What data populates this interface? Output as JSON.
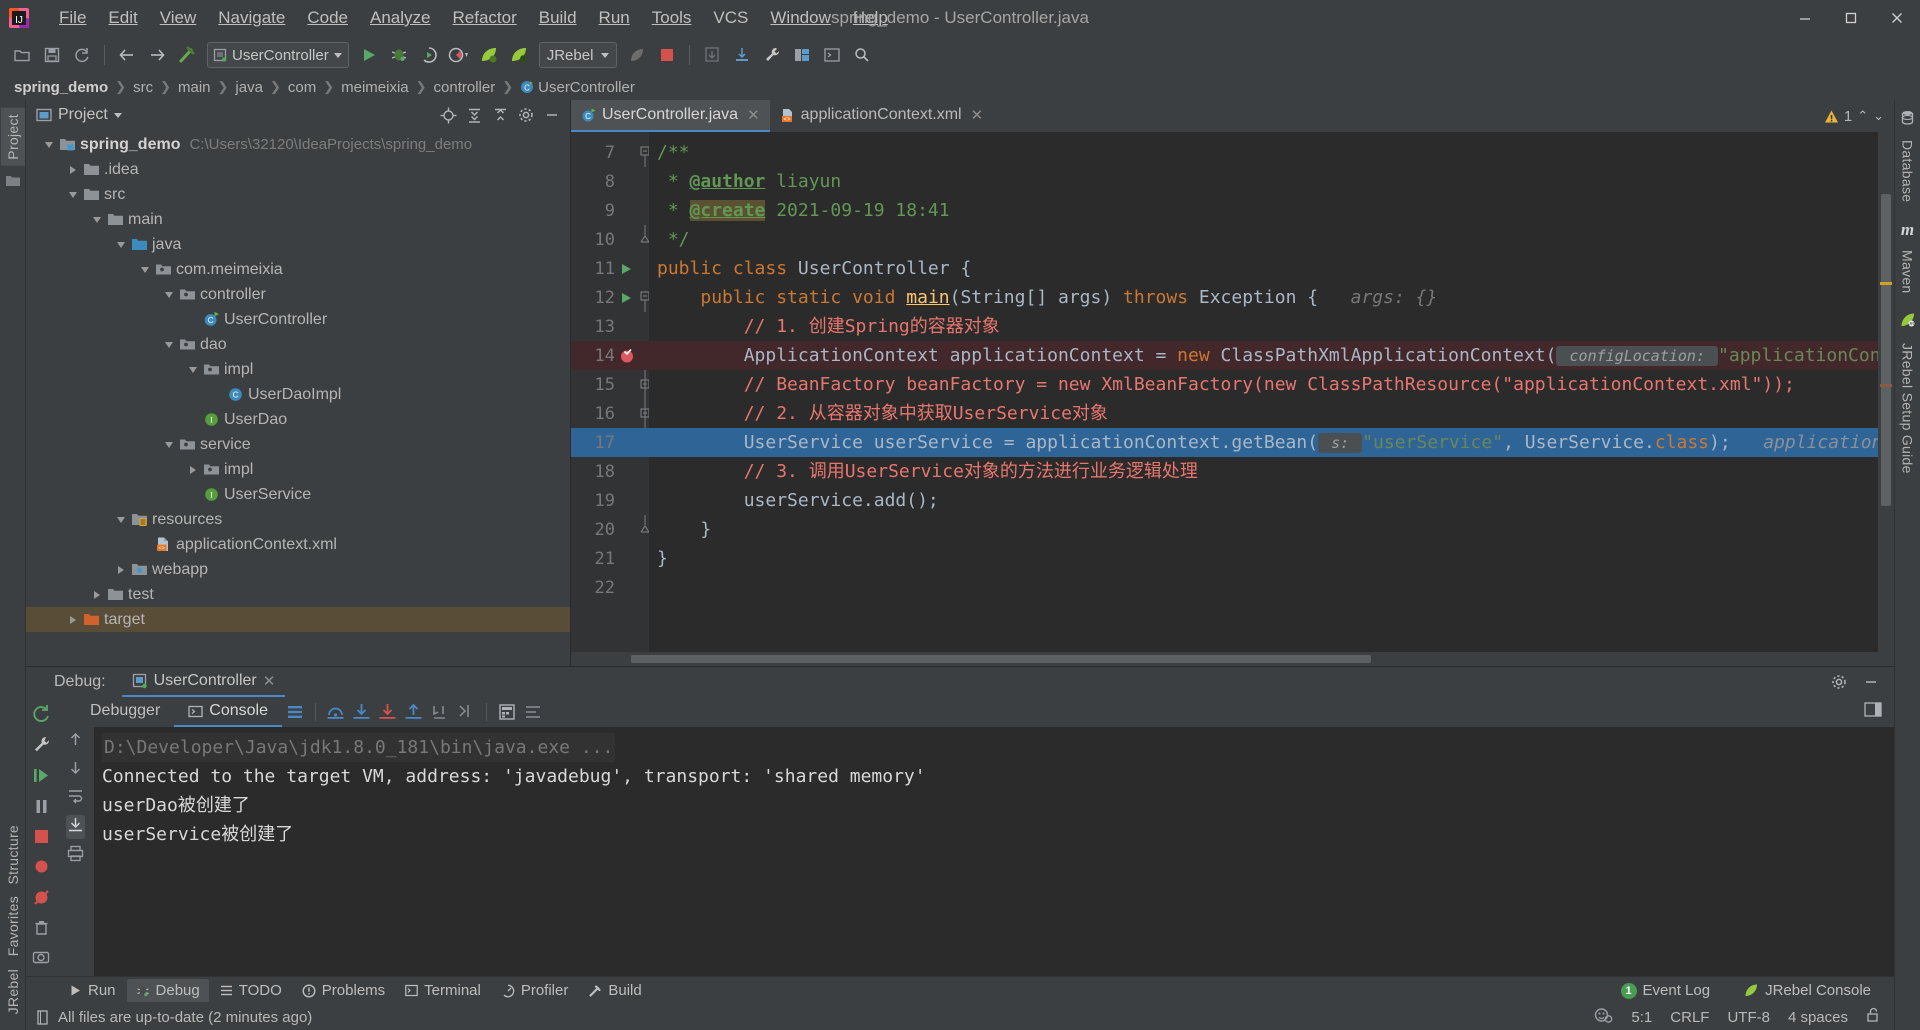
{
  "window": {
    "title": "spring_demo - UserController.java",
    "controls": [
      "minimize",
      "maximize",
      "close"
    ]
  },
  "menubar": [
    {
      "label": "File",
      "mnemonic": "F"
    },
    {
      "label": "Edit",
      "mnemonic": "E"
    },
    {
      "label": "View",
      "mnemonic": "V"
    },
    {
      "label": "Navigate",
      "mnemonic": "N"
    },
    {
      "label": "Code",
      "mnemonic": "C"
    },
    {
      "label": "Analyze",
      "mnemonic": "A"
    },
    {
      "label": "Refactor",
      "mnemonic": "R"
    },
    {
      "label": "Build",
      "mnemonic": "B"
    },
    {
      "label": "Run",
      "mnemonic": "u"
    },
    {
      "label": "Tools",
      "mnemonic": "T"
    },
    {
      "label": "VCS",
      "mnemonic": "V"
    },
    {
      "label": "Window",
      "mnemonic": "W"
    },
    {
      "label": "Help",
      "mnemonic": "H"
    }
  ],
  "toolbar": {
    "run_config": "UserController",
    "jrebel_label": "JRebel",
    "icons": [
      "open-folder-icon",
      "save-all-icon",
      "sync-icon",
      "back-arrow-icon",
      "forward-arrow-icon",
      "build-icon",
      "run-icon",
      "debug-icon",
      "run-coverage-icon",
      "profile-icon",
      "jrebel-run-icon",
      "jrebel-debug-icon",
      "attach-icon",
      "stop-icon",
      "layout-icon",
      "update-icon",
      "wrench-icon",
      "project-structure-icon",
      "terminal-icon",
      "search-everywhere-icon"
    ]
  },
  "breadcrumb": [
    {
      "label": "spring_demo",
      "bold": true,
      "icon": ""
    },
    {
      "label": "src",
      "bold": false,
      "icon": ""
    },
    {
      "label": "main",
      "bold": false,
      "icon": ""
    },
    {
      "label": "java",
      "bold": false,
      "icon": ""
    },
    {
      "label": "com",
      "bold": false,
      "icon": ""
    },
    {
      "label": "meimeixia",
      "bold": false,
      "icon": ""
    },
    {
      "label": "controller",
      "bold": false,
      "icon": ""
    },
    {
      "label": "UserController",
      "bold": false,
      "icon": "java-class-icon"
    }
  ],
  "left_tool_tabs": [
    {
      "label": "Project",
      "selected": true
    },
    {
      "label": "Structure",
      "selected": false
    },
    {
      "label": "Favorites",
      "selected": false
    },
    {
      "label": "JRebel",
      "selected": false
    }
  ],
  "right_tool_tabs": [
    {
      "label": "Database",
      "icon": "database-icon"
    },
    {
      "label": "Maven",
      "icon": "maven-m-icon"
    },
    {
      "label": "JRebel Setup Guide",
      "icon": "jrebel-leaf-icon"
    }
  ],
  "project_panel": {
    "title": "Project",
    "actions": [
      "locate-icon",
      "collapse-all-icon",
      "expand-icon",
      "settings-gear-icon",
      "hide-icon"
    ],
    "tree": [
      {
        "depth": 0,
        "twisty": "down",
        "icon": "module-folder-icon",
        "label": "spring_demo",
        "bold": true,
        "path": "C:\\Users\\32120\\IdeaProjects\\spring_demo",
        "highlight": false
      },
      {
        "depth": 1,
        "twisty": "right",
        "icon": "folder-icon",
        "label": ".idea",
        "bold": false,
        "path": "",
        "highlight": false
      },
      {
        "depth": 1,
        "twisty": "down",
        "icon": "folder-icon",
        "label": "src",
        "bold": false,
        "path": "",
        "highlight": false
      },
      {
        "depth": 2,
        "twisty": "down",
        "icon": "folder-icon",
        "label": "main",
        "bold": false,
        "path": "",
        "highlight": false
      },
      {
        "depth": 3,
        "twisty": "down",
        "icon": "source-folder-icon",
        "label": "java",
        "bold": false,
        "path": "",
        "highlight": false
      },
      {
        "depth": 4,
        "twisty": "down",
        "icon": "package-icon",
        "label": "com.meimeixia",
        "bold": false,
        "path": "",
        "highlight": false
      },
      {
        "depth": 5,
        "twisty": "down",
        "icon": "package-icon",
        "label": "controller",
        "bold": false,
        "path": "",
        "highlight": false
      },
      {
        "depth": 6,
        "twisty": "none",
        "icon": "java-class-run-icon",
        "label": "UserController",
        "bold": false,
        "path": "",
        "highlight": false
      },
      {
        "depth": 5,
        "twisty": "down",
        "icon": "package-icon",
        "label": "dao",
        "bold": false,
        "path": "",
        "highlight": false
      },
      {
        "depth": 6,
        "twisty": "down",
        "icon": "package-icon",
        "label": "impl",
        "bold": false,
        "path": "",
        "highlight": false
      },
      {
        "depth": 7,
        "twisty": "none",
        "icon": "java-class-icon",
        "label": "UserDaoImpl",
        "bold": false,
        "path": "",
        "highlight": false
      },
      {
        "depth": 6,
        "twisty": "none",
        "icon": "java-interface-icon",
        "label": "UserDao",
        "bold": false,
        "path": "",
        "highlight": false
      },
      {
        "depth": 5,
        "twisty": "down",
        "icon": "package-icon",
        "label": "service",
        "bold": false,
        "path": "",
        "highlight": false
      },
      {
        "depth": 6,
        "twisty": "right",
        "icon": "package-icon",
        "label": "impl",
        "bold": false,
        "path": "",
        "highlight": false
      },
      {
        "depth": 6,
        "twisty": "none",
        "icon": "java-interface-icon",
        "label": "UserService",
        "bold": false,
        "path": "",
        "highlight": false
      },
      {
        "depth": 3,
        "twisty": "down",
        "icon": "resource-folder-icon",
        "label": "resources",
        "bold": false,
        "path": "",
        "highlight": false
      },
      {
        "depth": 4,
        "twisty": "none",
        "icon": "xml-spring-icon",
        "label": "applicationContext.xml",
        "bold": false,
        "path": "",
        "highlight": false
      },
      {
        "depth": 3,
        "twisty": "right",
        "icon": "webapp-folder-icon",
        "label": "webapp",
        "bold": false,
        "path": "",
        "highlight": false
      },
      {
        "depth": 2,
        "twisty": "right",
        "icon": "folder-icon",
        "label": "test",
        "bold": false,
        "path": "",
        "highlight": false
      },
      {
        "depth": 1,
        "twisty": "right",
        "icon": "target-folder-icon",
        "label": "target",
        "bold": false,
        "path": "",
        "highlight": true
      }
    ]
  },
  "editor": {
    "tabs": [
      {
        "label": "UserController.java",
        "icon": "java-class-run-icon",
        "active": true,
        "closable": true
      },
      {
        "label": "applicationContext.xml",
        "icon": "xml-spring-icon",
        "active": false,
        "closable": true
      }
    ],
    "inspection": {
      "warning_count": "1",
      "icon": "warning-triangle-icon"
    },
    "first_line_number": 7,
    "lines": [
      {
        "n": 7,
        "marker": "",
        "fold": "fold-start",
        "state": "normal",
        "segments": [
          {
            "t": "/**",
            "c": "jdoc"
          }
        ]
      },
      {
        "n": 8,
        "marker": "",
        "fold": "",
        "state": "normal",
        "segments": [
          {
            "t": " * ",
            "c": "jdoc"
          },
          {
            "t": "@author",
            "c": "jdoc-tag"
          },
          {
            "t": " liayun",
            "c": "jdoc"
          }
        ]
      },
      {
        "n": 9,
        "marker": "",
        "fold": "",
        "state": "normal",
        "segments": [
          {
            "t": " * ",
            "c": "jdoc"
          },
          {
            "t": "@create",
            "c": "jdoc-tag-hl"
          },
          {
            "t": " 2021-09-19 18:41",
            "c": "jdoc"
          }
        ]
      },
      {
        "n": 10,
        "marker": "",
        "fold": "fold-end",
        "state": "normal",
        "segments": [
          {
            "t": " */",
            "c": "jdoc"
          }
        ]
      },
      {
        "n": 11,
        "marker": "run-gutter-icon",
        "fold": "",
        "state": "normal",
        "segments": [
          {
            "t": "public class ",
            "c": "kw"
          },
          {
            "t": "UserController ",
            "c": "cls"
          },
          {
            "t": "{",
            "c": "cls"
          }
        ]
      },
      {
        "n": 12,
        "marker": "run-gutter-icon",
        "fold": "fold-start",
        "state": "normal",
        "segments": [
          {
            "t": "    ",
            "c": "cls"
          },
          {
            "t": "public static void ",
            "c": "kw"
          },
          {
            "t": "main",
            "c": "mth"
          },
          {
            "t": "(String[] args) ",
            "c": "cls"
          },
          {
            "t": "throws ",
            "c": "kw"
          },
          {
            "t": "Exception {",
            "c": "cls"
          },
          {
            "t": "   args: {}",
            "c": "hint"
          }
        ]
      },
      {
        "n": 13,
        "marker": "",
        "fold": "",
        "state": "normal",
        "segments": [
          {
            "t": "        // 1. 创建Spring的容器对象",
            "c": "cmt-code"
          }
        ]
      },
      {
        "n": 14,
        "marker": "breakpoint-verified-icon",
        "fold": "",
        "state": "breakpoint",
        "segments": [
          {
            "t": "        ApplicationContext applicationContext = ",
            "c": "cls"
          },
          {
            "t": "new ",
            "c": "kw"
          },
          {
            "t": "ClassPathXmlApplicationContext(",
            "c": "cls"
          },
          {
            "t": " configLocation: ",
            "c": "hint-box"
          },
          {
            "t": "\"applicationConte",
            "c": "str"
          }
        ]
      },
      {
        "n": 15,
        "marker": "",
        "fold": "fold-mid",
        "state": "normal",
        "segments": [
          {
            "t": "        // BeanFactory beanFactory = new XmlBeanFactory(new ClassPathResource(\"applicationContext.xml\"));",
            "c": "cmt-code"
          }
        ]
      },
      {
        "n": 16,
        "marker": "",
        "fold": "fold-mid",
        "state": "normal",
        "segments": [
          {
            "t": "        // 2. 从容器对象中获取UserService对象",
            "c": "cmt-code"
          }
        ]
      },
      {
        "n": 17,
        "marker": "",
        "fold": "",
        "state": "current",
        "segments": [
          {
            "t": "        UserService userService = applicationContext.getBean(",
            "c": "cls"
          },
          {
            "t": " s: ",
            "c": "hint-box"
          },
          {
            "t": "\"userService\"",
            "c": "str"
          },
          {
            "t": ", ",
            "c": "cls"
          },
          {
            "t": "UserService.",
            "c": "cls"
          },
          {
            "t": "class",
            "c": "kw"
          },
          {
            "t": ");",
            "c": "cls"
          },
          {
            "t": "   applicationCo",
            "c": "ital"
          }
        ]
      },
      {
        "n": 18,
        "marker": "",
        "fold": "",
        "state": "normal",
        "segments": [
          {
            "t": "        // 3. 调用UserService对象的方法进行业务逻辑处理",
            "c": "cmt-code"
          }
        ]
      },
      {
        "n": 19,
        "marker": "",
        "fold": "",
        "state": "normal",
        "segments": [
          {
            "t": "        userService.add();",
            "c": "cls"
          }
        ]
      },
      {
        "n": 20,
        "marker": "",
        "fold": "fold-end",
        "state": "normal",
        "segments": [
          {
            "t": "    }",
            "c": "cls"
          }
        ]
      },
      {
        "n": 21,
        "marker": "",
        "fold": "",
        "state": "normal",
        "segments": [
          {
            "t": "}",
            "c": "cls"
          }
        ]
      },
      {
        "n": 22,
        "marker": "",
        "fold": "",
        "state": "normal",
        "segments": []
      }
    ]
  },
  "debug": {
    "label": "Debug:",
    "session_tab": "UserController",
    "tabs": [
      {
        "label": "Debugger",
        "icon": "",
        "selected": false
      },
      {
        "label": "Console",
        "icon": "console-icon",
        "selected": true
      }
    ],
    "toolbar_icons": [
      "rerun-icon",
      "layout-settings-icon",
      "step-over-icon",
      "step-into-icon",
      "force-step-into-icon",
      "step-out-icon",
      "drop-frame-icon",
      "run-to-cursor-icon",
      "evaluate-expression-icon",
      "settings-list-icon"
    ],
    "left_icons": [
      "rerun-green-icon",
      "wrench-icon",
      "resume-icon",
      "pause-icon",
      "stop-red-icon",
      "view-breakpoints-icon",
      "mute-breakpoints-icon",
      "trash-icon",
      "camera-icon",
      "jrebel-leaf-icon",
      "more-icon"
    ],
    "console_gutter_icons": [
      "scroll-up-icon",
      "scroll-down-icon",
      "soft-wrap-icon",
      "scroll-to-end-icon",
      "print-icon"
    ],
    "console_lines": [
      {
        "text": "D:\\Developer\\Java\\jdk1.8.0_181\\bin\\java.exe ...",
        "style": "command"
      },
      {
        "text": "Connected to the target VM, address: 'javadebug', transport: 'shared memory'",
        "style": "output"
      },
      {
        "text": "userDao被创建了",
        "style": "output"
      },
      {
        "text": "userService被创建了",
        "style": "output"
      }
    ]
  },
  "bottom_bar": {
    "items": [
      {
        "label": "Run",
        "icon": "run-icon",
        "selected": false
      },
      {
        "label": "Debug",
        "icon": "debug-icon",
        "selected": true
      },
      {
        "label": "TODO",
        "icon": "todo-icon",
        "selected": false
      },
      {
        "label": "Problems",
        "icon": "problems-icon",
        "selected": false
      },
      {
        "label": "Terminal",
        "icon": "terminal-icon",
        "selected": false
      },
      {
        "label": "Profiler",
        "icon": "profiler-icon",
        "selected": false
      },
      {
        "label": "Build",
        "icon": "build-icon",
        "selected": false
      }
    ],
    "right": [
      {
        "label": "Event Log",
        "badge": "1",
        "icon": "event-log-icon"
      },
      {
        "label": "JRebel Console",
        "badge": "",
        "icon": "jrebel-leaf-icon"
      }
    ]
  },
  "status_bar": {
    "message": "All files are up-to-date (2 minutes ago)",
    "message_icon": "document-icon",
    "right": [
      {
        "label": "",
        "icon": "inspection-face-icon"
      },
      {
        "label": "5:1",
        "icon": ""
      },
      {
        "label": "CRLF",
        "icon": ""
      },
      {
        "label": "UTF-8",
        "icon": ""
      },
      {
        "label": "4 spaces",
        "icon": ""
      },
      {
        "label": "",
        "icon": "lock-open-icon"
      }
    ]
  }
}
